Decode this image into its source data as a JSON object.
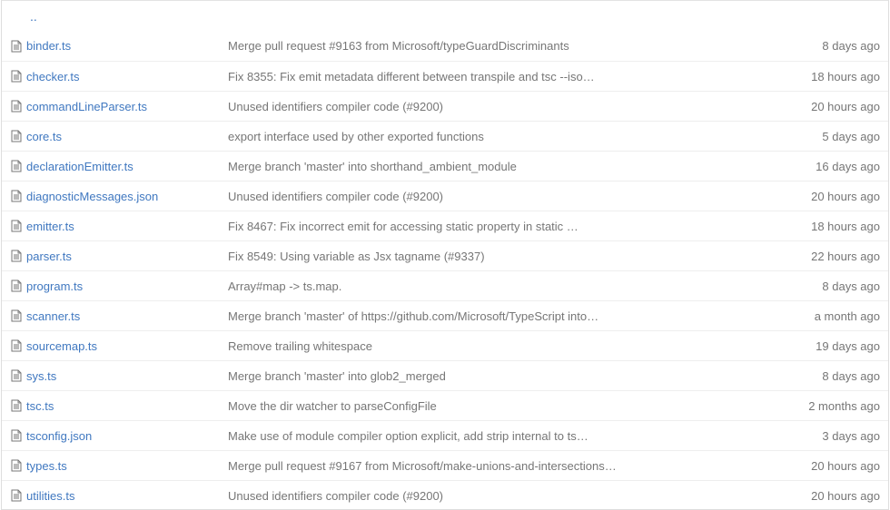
{
  "parent_link": "..",
  "rows": [
    {
      "name": "binder.ts",
      "message": "Merge pull request #9163 from Microsoft/typeGuardDiscriminants",
      "age": "8 days ago"
    },
    {
      "name": "checker.ts",
      "message": "Fix 8355: Fix emit metadata different between transpile and tsc --iso…",
      "age": "18 hours ago"
    },
    {
      "name": "commandLineParser.ts",
      "message": "Unused identifiers compiler code (#9200)",
      "age": "20 hours ago"
    },
    {
      "name": "core.ts",
      "message": "export interface used by other exported functions",
      "age": "5 days ago"
    },
    {
      "name": "declarationEmitter.ts",
      "message": "Merge branch 'master' into shorthand_ambient_module",
      "age": "16 days ago"
    },
    {
      "name": "diagnosticMessages.json",
      "message": "Unused identifiers compiler code (#9200)",
      "age": "20 hours ago"
    },
    {
      "name": "emitter.ts",
      "message": "Fix 8467: Fix incorrect emit for accessing static property in static …",
      "age": "18 hours ago"
    },
    {
      "name": "parser.ts",
      "message": "Fix 8549: Using variable as Jsx tagname (#9337)",
      "age": "22 hours ago"
    },
    {
      "name": "program.ts",
      "message": "Array#map -> ts.map.",
      "age": "8 days ago"
    },
    {
      "name": "scanner.ts",
      "message": "Merge branch 'master' of https://github.com/Microsoft/TypeScript into…",
      "age": "a month ago"
    },
    {
      "name": "sourcemap.ts",
      "message": "Remove trailing whitespace",
      "age": "19 days ago"
    },
    {
      "name": "sys.ts",
      "message": "Merge branch 'master' into glob2_merged",
      "age": "8 days ago"
    },
    {
      "name": "tsc.ts",
      "message": "Move the dir watcher to parseConfigFile",
      "age": "2 months ago"
    },
    {
      "name": "tsconfig.json",
      "message": "Make use of module compiler option explicit, add strip internal to ts…",
      "age": "3 days ago"
    },
    {
      "name": "types.ts",
      "message": "Merge pull request #9167 from Microsoft/make-unions-and-intersections…",
      "age": "20 hours ago"
    },
    {
      "name": "utilities.ts",
      "message": "Unused identifiers compiler code (#9200)",
      "age": "20 hours ago"
    }
  ]
}
